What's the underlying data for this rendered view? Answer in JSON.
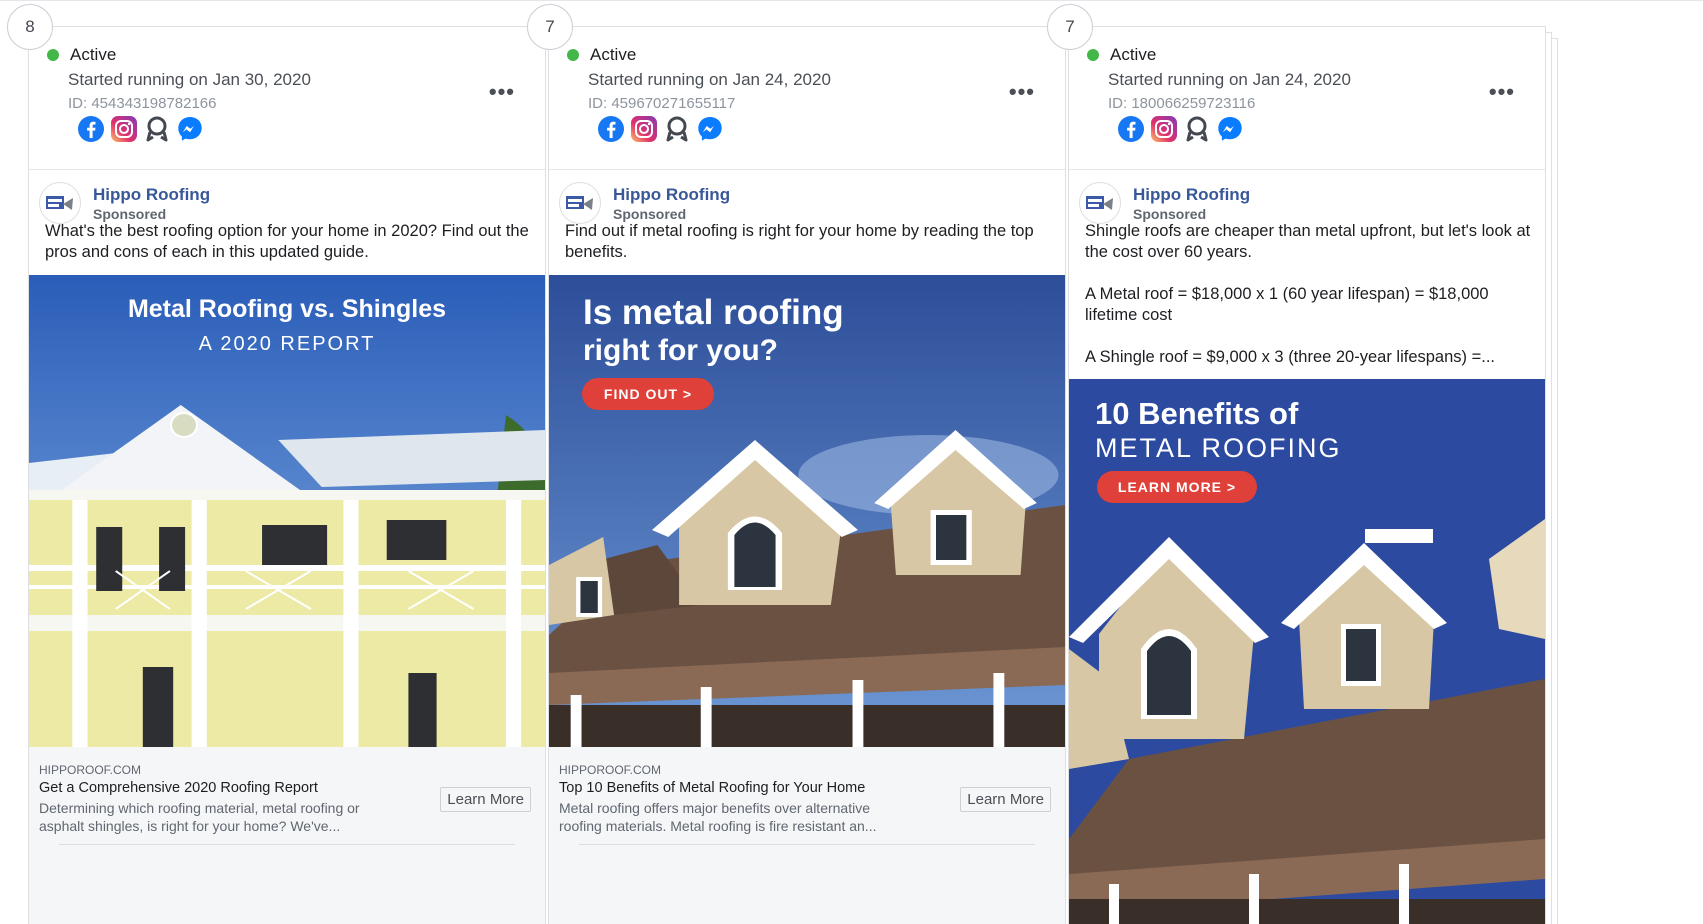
{
  "cards": [
    {
      "count": "8",
      "status": "Active",
      "started": "Started running on Jan 30, 2020",
      "id": "ID: 454343198782166",
      "more": "•••",
      "advertiser": "Hippo Roofing",
      "sponsored": "Sponsored",
      "text": [
        "What's the best roofing option for your home in 2020? Find out the pros and cons of each in this updated guide."
      ],
      "creative": {
        "line1": "Metal Roofing vs. Shingles",
        "line2": "A 2020 REPORT"
      },
      "footer": {
        "domain": "HIPPOROOF.COM",
        "headline": "Get a Comprehensive 2020 Roofing Report",
        "description": "Determining which roofing material, metal roofing or asphalt shingles, is right for your home? We've...",
        "cta": "Learn More"
      }
    },
    {
      "count": "7",
      "status": "Active",
      "started": "Started running on Jan 24, 2020",
      "id": "ID: 459670271655117",
      "more": "•••",
      "advertiser": "Hippo Roofing",
      "sponsored": "Sponsored",
      "text": [
        "Find out if metal roofing is right for your home by reading the top benefits."
      ],
      "creative": {
        "line1": "Is metal roofing",
        "line2": "right for you?",
        "button": "FIND OUT >"
      },
      "footer": {
        "domain": "HIPPOROOF.COM",
        "headline": "Top 10 Benefits of Metal Roofing for Your Home",
        "description": "Metal roofing offers major benefits over alternative roofing materials. Metal roofing is fire resistant an...",
        "cta": "Learn More"
      }
    },
    {
      "count": "7",
      "status": "Active",
      "started": "Started running on Jan 24, 2020",
      "id": "ID: 180066259723116",
      "more": "•••",
      "advertiser": "Hippo Roofing",
      "sponsored": "Sponsored",
      "text": [
        "Shingle roofs are cheaper than metal upfront, but let's look at the cost over 60 years.",
        "A Metal roof = $18,000 x 1 (60 year lifespan) = $18,000 lifetime cost",
        "A Shingle roof = $9,000 x 3 (three 20-year lifespans) =..."
      ],
      "creative": {
        "line1": "10 Benefits of",
        "line2": "METAL ROOFING",
        "button": "LEARN MORE >"
      }
    }
  ],
  "platform_icons": [
    "facebook-icon",
    "instagram-icon",
    "audience-network-icon",
    "messenger-icon"
  ],
  "colors": {
    "active_green": "#44b74a",
    "advertiser_blue": "#385898",
    "cta_red": "#e0403a",
    "creative_blue": "#2b4aa0"
  }
}
